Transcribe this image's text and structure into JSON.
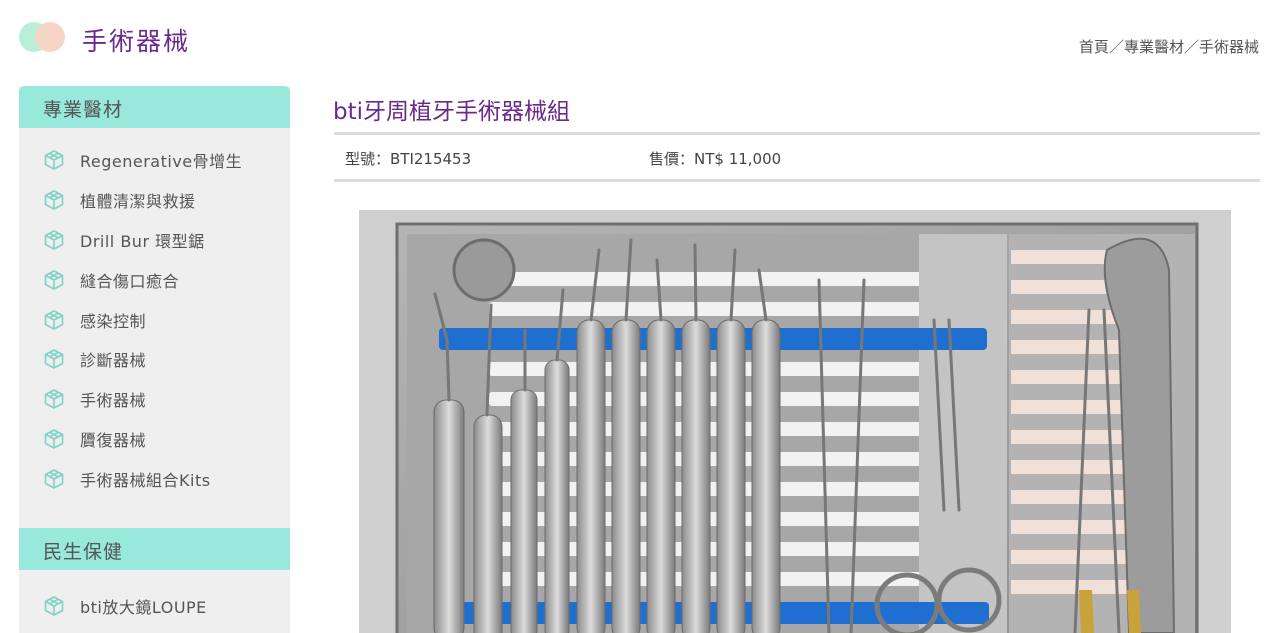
{
  "header": {
    "title": "手術器械",
    "breadcrumb": [
      "首頁",
      "專業醫材",
      "手術器械"
    ],
    "breadcrumb_sep": "／"
  },
  "sidebar": {
    "sections": [
      {
        "title": "專業醫材",
        "items": [
          "Regenerative骨增生",
          "植體清潔與救援",
          "Drill Bur 環型鋸",
          "縫合傷口癒合",
          "感染控制",
          "診斷器械",
          "手術器械",
          "贗復器械",
          "手術器械組合Kits"
        ]
      },
      {
        "title": "民生保健",
        "items": [
          "bti放大鏡LOUPE"
        ]
      }
    ],
    "item_icon": "cube-outline-icon"
  },
  "product": {
    "title": "bti牙周植牙手術器械組",
    "model": "型號：BTI215453",
    "price": "售價：NT$  11,000",
    "image": "dental-instrument-tray-photo"
  },
  "colors": {
    "accent_purple": "#6a2a8c",
    "section_mint": "#98e8dc",
    "icon_teal": "#7dd3c8",
    "sidebar_bg": "#efefef",
    "tray_blue": "#1f6fd0"
  }
}
